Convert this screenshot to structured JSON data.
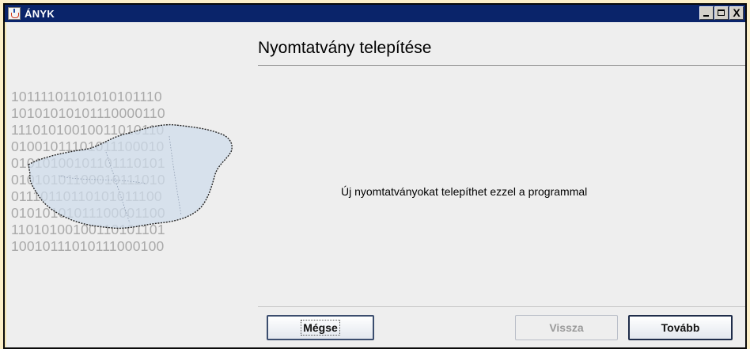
{
  "window": {
    "title": "ÁNYK",
    "controls": {
      "minimize": "minimize",
      "maximize": "maximize",
      "close": "X"
    }
  },
  "page": {
    "title": "Nyomtatvány telepítése",
    "message": "Új nyomtatványokat telepíthet ezzel a programmal"
  },
  "decoration": {
    "binary_lines": [
      "10111101101010101110",
      "10101010101110000110",
      "11101010010011010110",
      "01001011101011100010",
      "01010100101101110101",
      "01010101100010111010",
      "01110110110101011100",
      "01010101011100001100",
      "11010100100110101101",
      "10010111010111000100"
    ],
    "map_label": "hungary-map"
  },
  "buttons": {
    "cancel": "Mégse",
    "back": "Vissza",
    "next": "Tovább"
  },
  "colors": {
    "titlebar": "#0a246a",
    "background": "#eeeeee",
    "outer_background": "#fcefc8",
    "binary_text": "#a9a9a9",
    "map_fill": "#cfdcec",
    "disabled_text": "#9a9a9a"
  }
}
